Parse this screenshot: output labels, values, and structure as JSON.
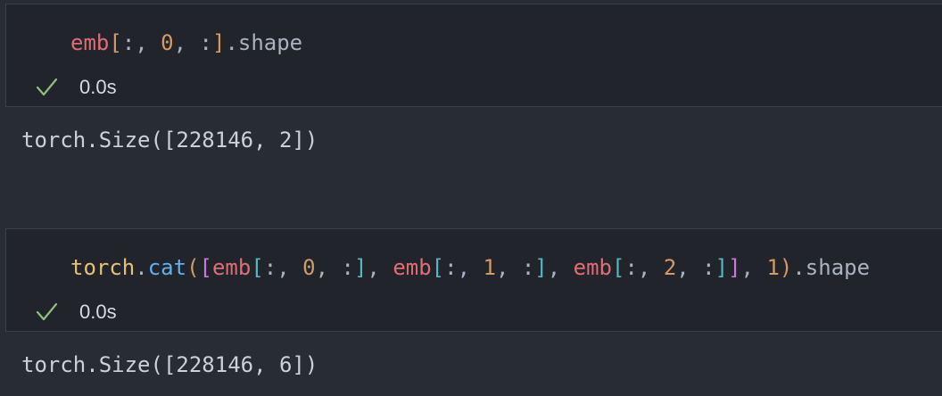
{
  "cells": [
    {
      "code_tokens": [
        {
          "text": "emb",
          "kind": "var"
        },
        {
          "text": "[",
          "kind": "bracket-1"
        },
        {
          "text": ":, ",
          "kind": "plain"
        },
        {
          "text": "0",
          "kind": "num"
        },
        {
          "text": ", :",
          "kind": "plain"
        },
        {
          "text": "]",
          "kind": "bracket-1"
        },
        {
          "text": ".shape",
          "kind": "attr"
        }
      ],
      "status_time": "0.0s",
      "output": "torch.Size([228146, 2])"
    },
    {
      "code_tokens": [
        {
          "text": "torch",
          "kind": "mod"
        },
        {
          "text": ".",
          "kind": "plain"
        },
        {
          "text": "cat",
          "kind": "fn"
        },
        {
          "text": "(",
          "kind": "bracket-1"
        },
        {
          "text": "[",
          "kind": "bracket-3"
        },
        {
          "text": "emb",
          "kind": "var"
        },
        {
          "text": "[",
          "kind": "bracket-2"
        },
        {
          "text": ":, ",
          "kind": "plain"
        },
        {
          "text": "0",
          "kind": "num"
        },
        {
          "text": ", :",
          "kind": "plain"
        },
        {
          "text": "]",
          "kind": "bracket-2"
        },
        {
          "text": ", ",
          "kind": "plain"
        },
        {
          "text": "emb",
          "kind": "var"
        },
        {
          "text": "[",
          "kind": "bracket-2"
        },
        {
          "text": ":, ",
          "kind": "plain"
        },
        {
          "text": "1",
          "kind": "num"
        },
        {
          "text": ", :",
          "kind": "plain"
        },
        {
          "text": "]",
          "kind": "bracket-2"
        },
        {
          "text": ", ",
          "kind": "plain"
        },
        {
          "text": "emb",
          "kind": "var"
        },
        {
          "text": "[",
          "kind": "bracket-2"
        },
        {
          "text": ":, ",
          "kind": "plain"
        },
        {
          "text": "2",
          "kind": "num"
        },
        {
          "text": ", :",
          "kind": "plain"
        },
        {
          "text": "]",
          "kind": "bracket-2"
        },
        {
          "text": "]",
          "kind": "bracket-3"
        },
        {
          "text": ", ",
          "kind": "plain"
        },
        {
          "text": "1",
          "kind": "num"
        },
        {
          "text": ")",
          "kind": "bracket-1"
        },
        {
          "text": ".shape",
          "kind": "attr"
        }
      ],
      "status_time": "0.0s",
      "output": "torch.Size([228146, 6])"
    }
  ],
  "icons": {
    "status": "check-icon"
  },
  "colors": {
    "background": "#282c34",
    "cell_background": "#21252b",
    "check": "#8fbf7f"
  }
}
